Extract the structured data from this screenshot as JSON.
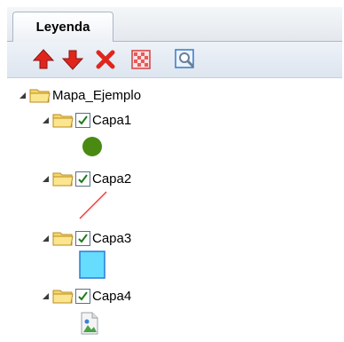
{
  "legend": {
    "tab_label": "Leyenda",
    "toolbar": [
      {
        "name": "move-up-icon",
        "color": "#e0261c"
      },
      {
        "name": "move-down-icon",
        "color": "#e0261c"
      },
      {
        "name": "delete-icon",
        "color": "#e0261c"
      },
      {
        "name": "layer-style-icon",
        "color": "#e55a5a"
      },
      {
        "name": "zoom-to-layer-icon",
        "color": "#3b78c2"
      }
    ],
    "tree": {
      "root_label": "Mapa_Ejemplo",
      "layers": [
        {
          "label": "Capa1",
          "checked": true,
          "symbol": "point",
          "color": "#4a8a12"
        },
        {
          "label": "Capa2",
          "checked": true,
          "symbol": "line",
          "color": "#ff2a2a"
        },
        {
          "label": "Capa3",
          "checked": true,
          "symbol": "polygon",
          "color": "#66ddff",
          "stroke": "#2a7ad8"
        },
        {
          "label": "Capa4",
          "checked": true,
          "symbol": "image"
        }
      ]
    }
  }
}
